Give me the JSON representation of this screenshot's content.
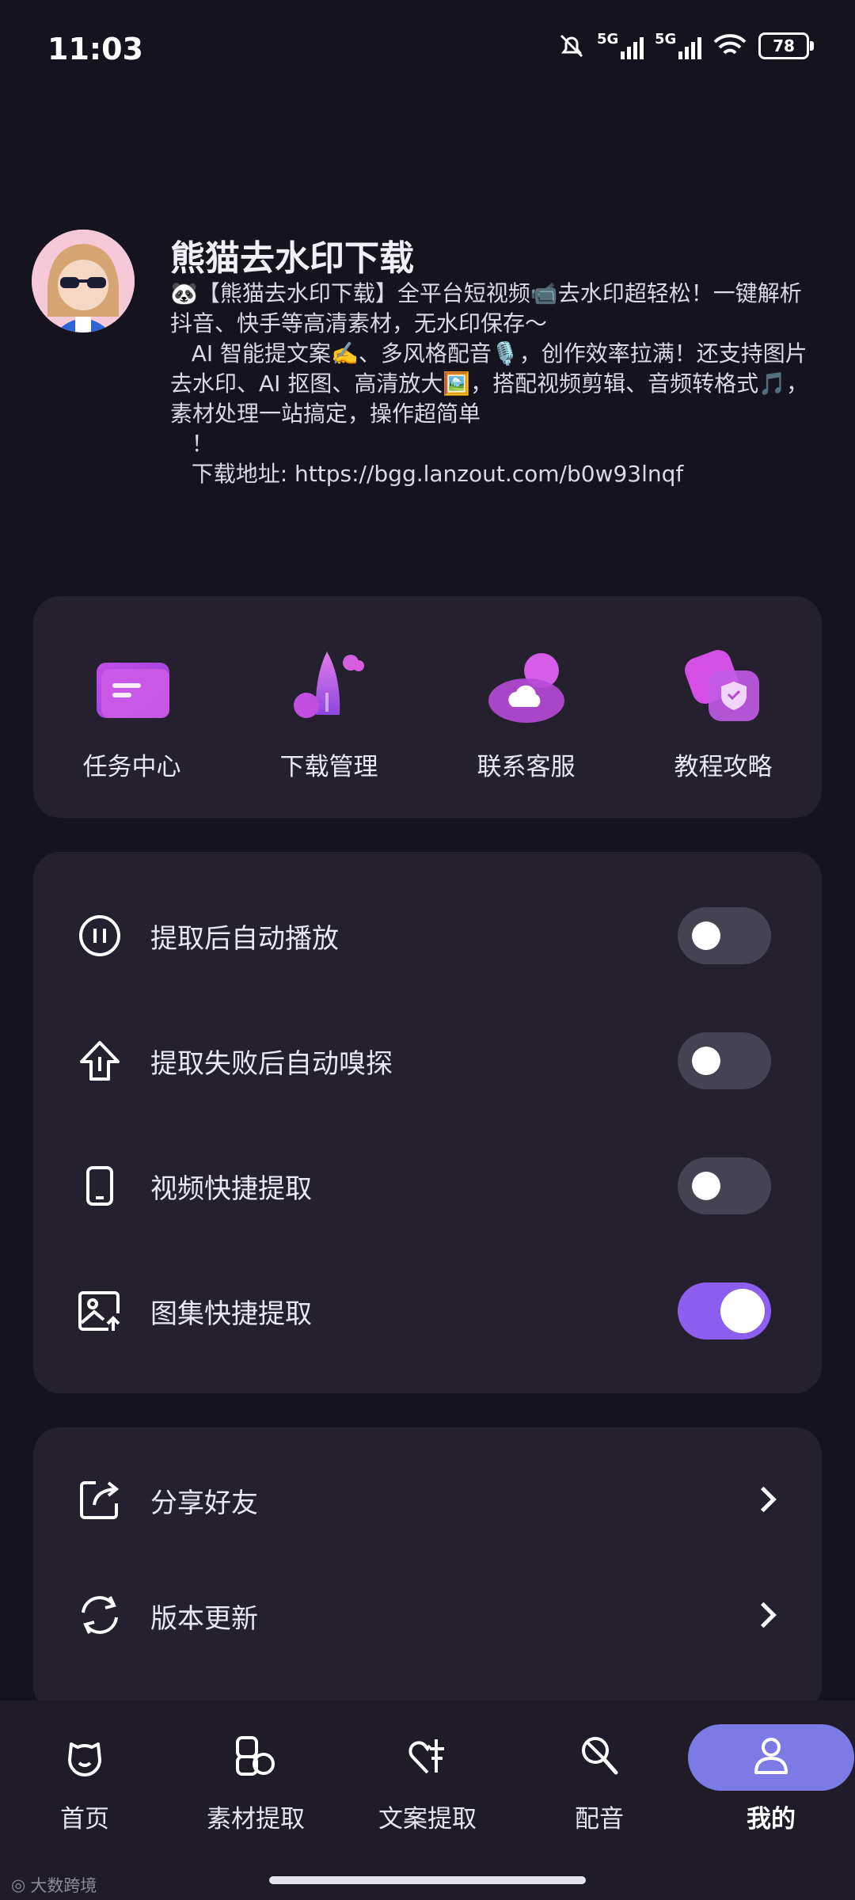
{
  "status_bar": {
    "time": "11:03",
    "network_1": "5G",
    "network_2": "5G",
    "battery": "78"
  },
  "profile": {
    "name": "熊猫去水印下载",
    "description": "🐼【熊猫去水印下载】全平台短视频📹去水印超轻松！一键解析抖音、快手等高清素材，无水印保存～\n   AI 智能提文案✍️、多风格配音🎙️，创作效率拉满！还支持图片去水印、AI 抠图、高清放大🖼️，搭配视频剪辑、音频转格式🎵，素材处理一站搞定，操作超简单\n   ！\n   下载地址: https://bgg.lanzout.com/b0w93lnqf"
  },
  "quick_actions": [
    {
      "label": "任务中心",
      "icon": "folder-icon"
    },
    {
      "label": "下载管理",
      "icon": "rocket-icon"
    },
    {
      "label": "联系客服",
      "icon": "cloud-icon"
    },
    {
      "label": "教程攻略",
      "icon": "shield-icon"
    }
  ],
  "settings": [
    {
      "label": "提取后自动播放",
      "icon": "pause-circle-icon",
      "on": false
    },
    {
      "label": "提取失败后自动嗅探",
      "icon": "upload-arrow-icon",
      "on": false
    },
    {
      "label": "视频快捷提取",
      "icon": "phone-icon",
      "on": false
    },
    {
      "label": "图集快捷提取",
      "icon": "image-upload-icon",
      "on": true
    }
  ],
  "links": [
    {
      "label": "分享好友",
      "icon": "share-icon"
    },
    {
      "label": "版本更新",
      "icon": "refresh-icon"
    }
  ],
  "bottom_nav": [
    {
      "label": "首页",
      "icon": "home-icon",
      "active": false
    },
    {
      "label": "素材提取",
      "icon": "material-icon",
      "active": false
    },
    {
      "label": "文案提取",
      "icon": "text-heart-icon",
      "active": false
    },
    {
      "label": "配音",
      "icon": "mic-icon",
      "active": false
    },
    {
      "label": "我的",
      "icon": "user-icon",
      "active": true
    }
  ],
  "watermark": "大数跨境",
  "colors": {
    "background": "#15131d",
    "card": "#24202e",
    "accent": "#8d5ff0",
    "nav_active": "#7c7be6"
  }
}
